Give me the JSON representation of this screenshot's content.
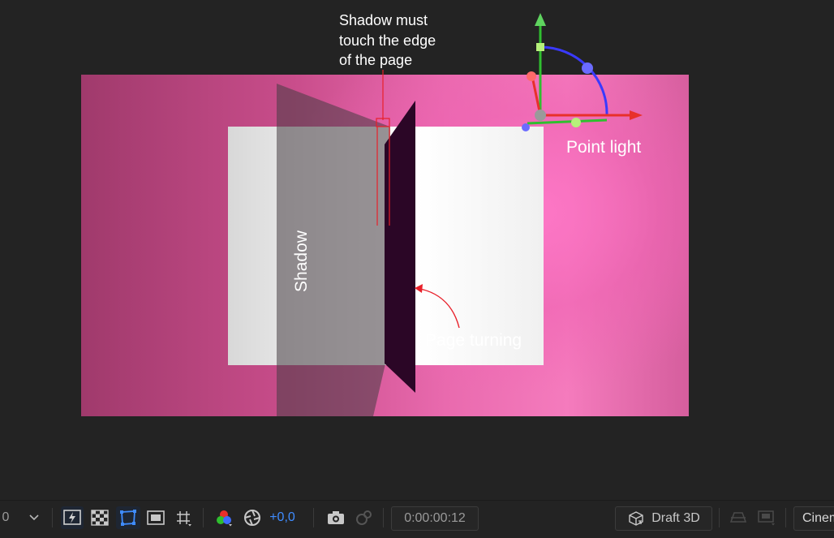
{
  "annotations": {
    "shadow_note": [
      "Shadow must",
      "touch the edge",
      "of the page"
    ],
    "point_light": "Point light",
    "shadow": "Shadow",
    "page_turning": "Page turning"
  },
  "toolbar": {
    "zoom_partial": "0",
    "exposure_value": "+0,0",
    "timecode": "0:00:00:12",
    "renderer_label": "Draft 3D",
    "camera_partial": "Cinem"
  },
  "colors": {
    "background": "#232323",
    "annotation_red": "#e8202a",
    "accent_blue": "#3f8cff"
  }
}
